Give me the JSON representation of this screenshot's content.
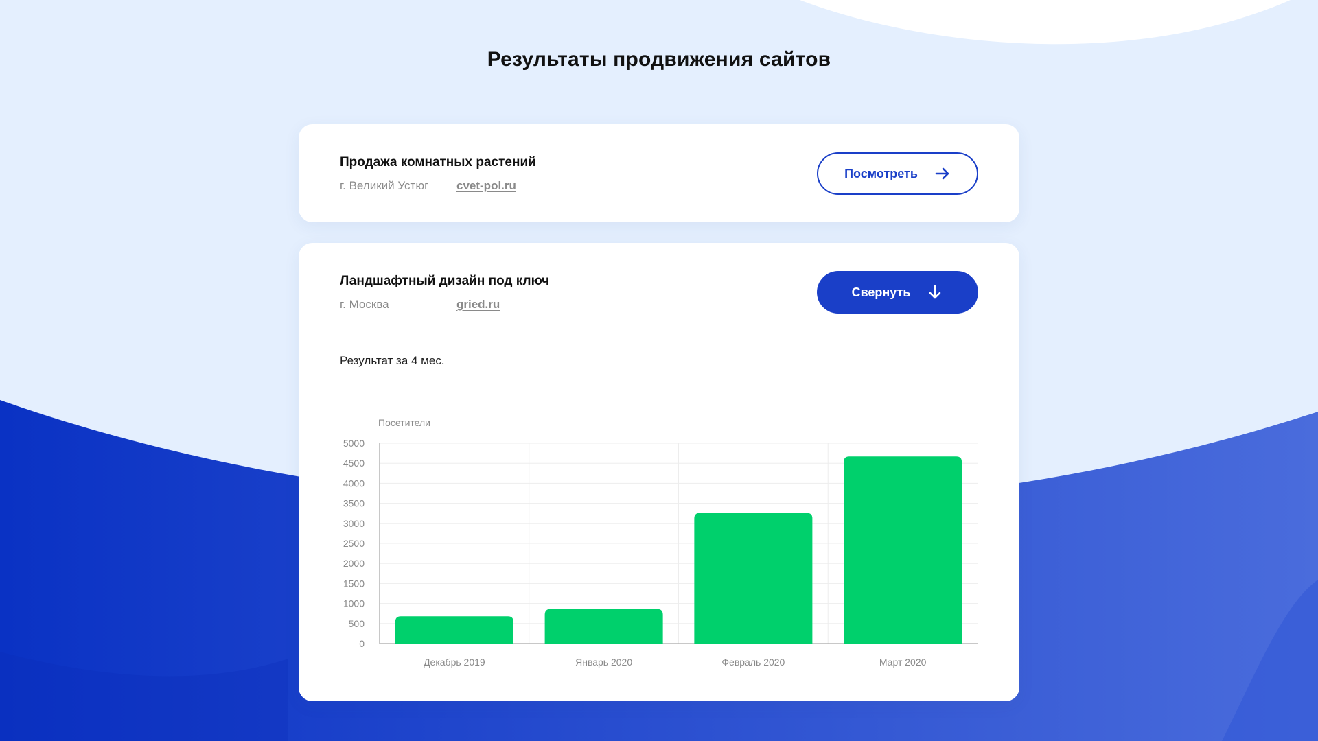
{
  "page": {
    "title": "Результаты продвижения сайтов"
  },
  "colors": {
    "accent": "#1a3fc8",
    "bar": "#00d06c",
    "background": "#e4effe"
  },
  "projects": [
    {
      "title": "Продажа комнатных растений",
      "city": "г. Великий Устюг",
      "site": "cvet-pol.ru",
      "button_label": "Посмотреть",
      "button_icon": "arrow-right-icon"
    },
    {
      "title": "Ландшафтный дизайн под ключ",
      "city": "г. Москва",
      "site": "gried.ru",
      "button_label": "Свернуть",
      "button_icon": "arrow-down-icon",
      "result_label": "Результат за 4 мес."
    }
  ],
  "chart_data": {
    "type": "bar",
    "ylabel": "Посетители",
    "categories": [
      "Декабрь 2019",
      "Январь 2020",
      "Февраль 2020",
      "Март 2020"
    ],
    "values": [
      680,
      860,
      3260,
      4670
    ],
    "ylim": [
      0,
      5000
    ],
    "yticks": [
      0,
      500,
      1000,
      1500,
      2000,
      2500,
      3000,
      3500,
      4000,
      4500,
      5000
    ],
    "grid": true
  }
}
